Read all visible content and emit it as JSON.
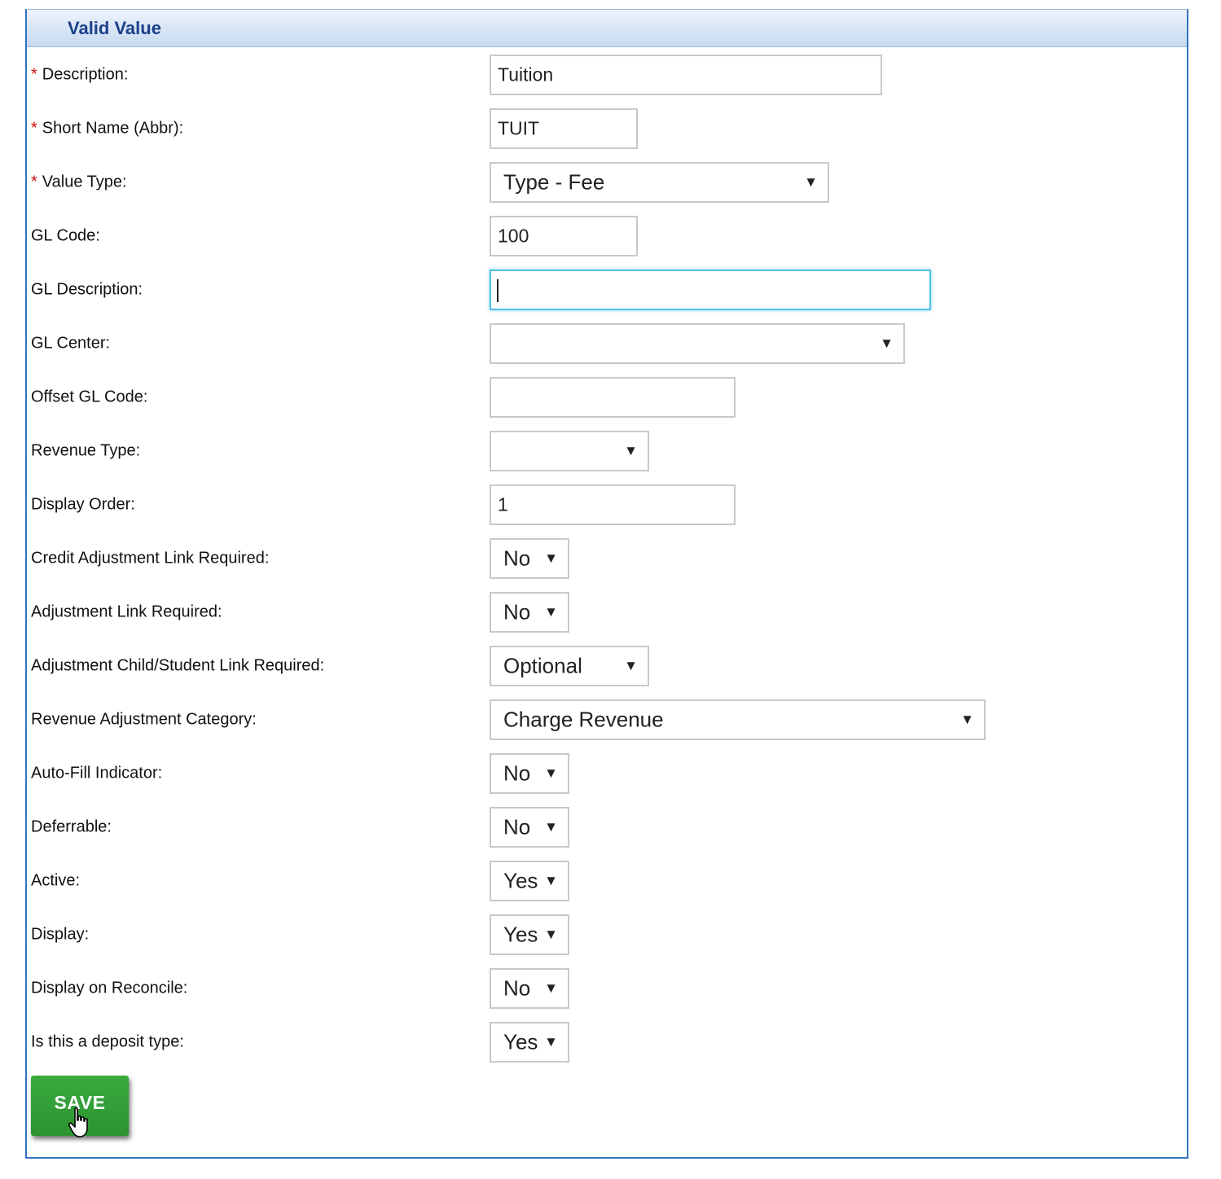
{
  "panel": {
    "title": "Valid Value"
  },
  "form": {
    "description": {
      "label": "Description:",
      "required": true,
      "value": "Tuition"
    },
    "short_name": {
      "label": "Short Name (Abbr):",
      "required": true,
      "value": "TUIT"
    },
    "value_type": {
      "label": "Value Type:",
      "required": true,
      "value": "Type - Fee"
    },
    "gl_code": {
      "label": "GL Code:",
      "value": "100"
    },
    "gl_description": {
      "label": "GL Description:",
      "value": ""
    },
    "gl_center": {
      "label": "GL Center:",
      "value": ""
    },
    "offset_gl_code": {
      "label": "Offset GL Code:",
      "value": ""
    },
    "revenue_type": {
      "label": "Revenue Type:",
      "value": ""
    },
    "display_order": {
      "label": "Display Order:",
      "value": "1"
    },
    "credit_adjustment_link_required": {
      "label": "Credit Adjustment Link Required:",
      "value": "No"
    },
    "adjustment_link_required": {
      "label": "Adjustment Link Required:",
      "value": "No"
    },
    "adjustment_child_student_link_required": {
      "label": "Adjustment Child/Student Link Required:",
      "value": "Optional"
    },
    "revenue_adjustment_category": {
      "label": "Revenue Adjustment Category:",
      "value": "Charge Revenue"
    },
    "auto_fill_indicator": {
      "label": "Auto-Fill Indicator:",
      "value": "No"
    },
    "deferrable": {
      "label": "Deferrable:",
      "value": "No"
    },
    "active": {
      "label": "Active:",
      "value": "Yes"
    },
    "display": {
      "label": "Display:",
      "value": "Yes"
    },
    "display_on_reconcile": {
      "label": "Display on Reconcile:",
      "value": "No"
    },
    "is_deposit_type": {
      "label": "Is this a deposit type:",
      "value": "Yes"
    }
  },
  "required_marker": "*",
  "dropdown_arrow": "▼",
  "save_button": {
    "label": "SAVE"
  },
  "colors": {
    "header_title": "#1c3f8a",
    "panel_border": "#2f74c1",
    "required": "#d01010",
    "save_button": "#2c9431",
    "focus": "#52c2e6"
  },
  "icons": {
    "dropdown": "chevron-down-icon",
    "cursor": "hand-pointer-icon"
  }
}
